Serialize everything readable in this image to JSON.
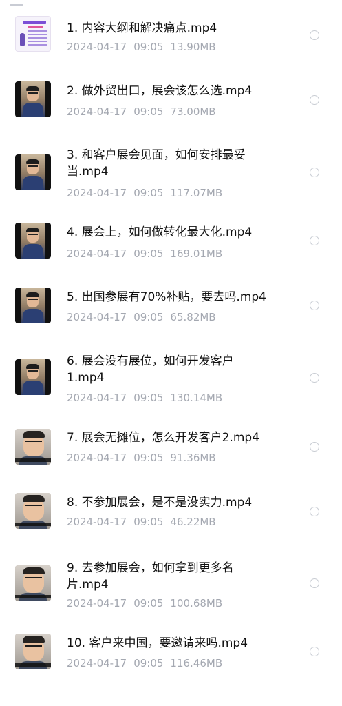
{
  "files": [
    {
      "title": "1. 内容大纲和解决痛点.mp4",
      "date": "2024-04-17",
      "time": "09:05",
      "size": "13.90MB",
      "thumb": "doc"
    },
    {
      "title": "2. 做外贸出口，展会该怎么选.mp4",
      "date": "2024-04-17",
      "time": "09:05",
      "size": "73.00MB",
      "thumb": "dark"
    },
    {
      "title": "3. 和客户展会见面，如何安排最妥当.mp4",
      "date": "2024-04-17",
      "time": "09:05",
      "size": "117.07MB",
      "thumb": "dark"
    },
    {
      "title": "4. 展会上，如何做转化最大化.mp4",
      "date": "2024-04-17",
      "time": "09:05",
      "size": "169.01MB",
      "thumb": "dark"
    },
    {
      "title": "5. 出国参展有70%补贴，要去吗.mp4",
      "date": "2024-04-17",
      "time": "09:05",
      "size": "65.82MB",
      "thumb": "dark"
    },
    {
      "title": "6. 展会没有展位，如何开发客户1.mp4",
      "date": "2024-04-17",
      "time": "09:05",
      "size": "130.14MB",
      "thumb": "dark"
    },
    {
      "title": "7. 展会无摊位，怎么开发客户2.mp4",
      "date": "2024-04-17",
      "time": "09:05",
      "size": "91.36MB",
      "thumb": "light"
    },
    {
      "title": "8. 不参加展会，是不是没实力.mp4",
      "date": "2024-04-17",
      "time": "09:05",
      "size": "46.22MB",
      "thumb": "light"
    },
    {
      "title": "9. 去参加展会，如何拿到更多名片.mp4",
      "date": "2024-04-17",
      "time": "09:05",
      "size": "100.68MB",
      "thumb": "light"
    },
    {
      "title": "10. 客户来中国，要邀请来吗.mp4",
      "date": "2024-04-17",
      "time": "09:05",
      "size": "116.46MB",
      "thumb": "light"
    }
  ],
  "icons": {
    "file_thumbnail": "video-thumbnail-icon",
    "select": "radio-circle-icon"
  },
  "colors": {
    "title": "#111111",
    "meta": "#a4a8b1",
    "radio_border": "#c8ccd3"
  }
}
